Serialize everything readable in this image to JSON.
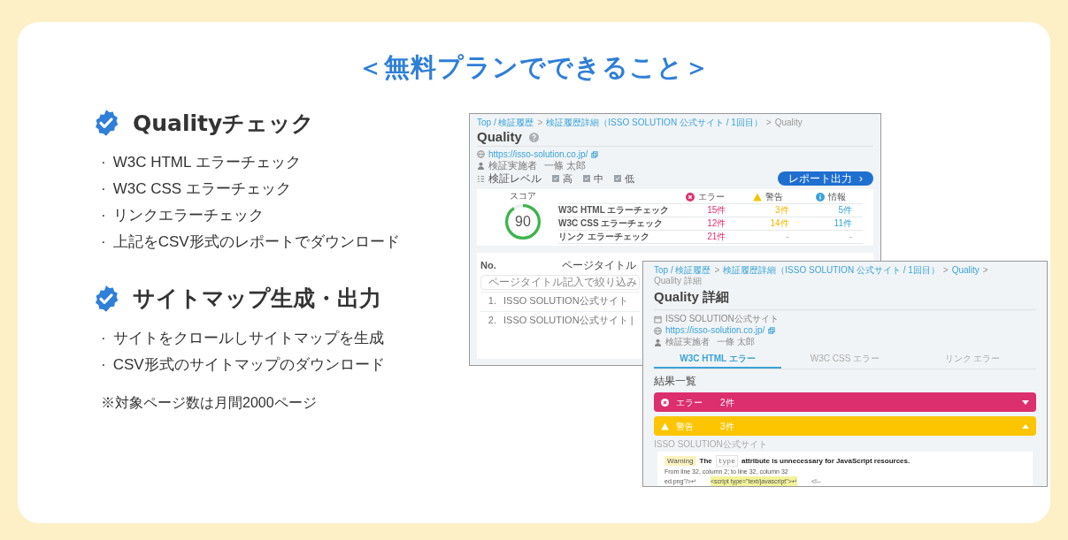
{
  "heading": "＜無料プランでできること＞",
  "features": [
    {
      "title": "Qualityチェック",
      "items": [
        {
          "marker": "·",
          "text": "W3C HTML エラーチェック"
        },
        {
          "marker": "·",
          "text": "W3C CSS エラーチェック"
        },
        {
          "marker": "·",
          "text": "リンクエラーチェック"
        },
        {
          "marker": "·",
          "text": "上記をCSV形式のレポートでダウンロード"
        }
      ]
    },
    {
      "title": "サイトマップ生成・出力",
      "items": [
        {
          "marker": "·",
          "text": "サイトをクロールしサイトマップを生成"
        },
        {
          "marker": "·",
          "text": "CSV形式のサイトマップのダウンロード"
        }
      ]
    }
  ],
  "note": "※対象ページ数は月間2000ページ",
  "quality_screen": {
    "breadcrumb": [
      {
        "label": "Top / 検証履歴",
        "link": true
      },
      {
        "label": ">",
        "link": false
      },
      {
        "label": "検証履歴詳細（ISSO SOLUTION 公式サイト / 1回目）",
        "link": true
      },
      {
        "label": ">",
        "link": false
      },
      {
        "label": "Quality",
        "link": false
      }
    ],
    "title": "Quality",
    "url": "https://isso-solution.co.jp/",
    "inspector_label": "検証実施者",
    "inspector": "一條 太郎",
    "level_label": "検証レベル",
    "levels": [
      {
        "label": "高",
        "checked": true
      },
      {
        "label": "中",
        "checked": true
      },
      {
        "label": "低",
        "checked": true
      }
    ],
    "report_button": "レポート出力",
    "report_button_icon": "›",
    "score_label": "スコア",
    "score": "90",
    "columns": [
      {
        "label": "エラー",
        "kind": "error"
      },
      {
        "label": "警告",
        "kind": "warning"
      },
      {
        "label": "情報",
        "kind": "info"
      }
    ],
    "rows": [
      {
        "label": "W3C HTML エラーチェック",
        "values": [
          "15件",
          "3件",
          "5件"
        ]
      },
      {
        "label": "W3C CSS エラーチェック",
        "values": [
          "12件",
          "14件",
          "11件"
        ]
      },
      {
        "label": "リンク エラーチェック",
        "values": [
          "21件",
          "-",
          "-"
        ]
      }
    ],
    "pages_table": {
      "no_header": "No.",
      "title_header": "ページタイトル",
      "search_placeholder": "ページタイトル記入で絞り込み",
      "rows": [
        {
          "no": "1.",
          "title": "ISSO SOLUTION公式サイト"
        },
        {
          "no": "2.",
          "title": "ISSO SOLUTION公式サイト |"
        }
      ]
    }
  },
  "detail_screen": {
    "breadcrumb": [
      {
        "label": "Top / 検証履歴",
        "link": true
      },
      {
        "label": ">",
        "link": false
      },
      {
        "label": "検証履歴詳細（ISSO SOLUTION 公式サイト / 1回目）",
        "link": true
      },
      {
        "label": ">",
        "link": false
      },
      {
        "label": "Quality",
        "link": true
      },
      {
        "label": ">",
        "link": false
      },
      {
        "label": "Quality 詳細",
        "link": false
      }
    ],
    "title": "Quality 詳細",
    "site": "ISSO SOLUTION公式サイト",
    "url": "https://isso-solution.co.jp/",
    "inspector_label": "検証実施者",
    "inspector": "一條 太郎",
    "tabs": [
      {
        "label": "W3C HTML エラー",
        "selected": true
      },
      {
        "label": "W3C CSS エラー",
        "selected": false
      },
      {
        "label": "リンク エラー",
        "selected": false
      }
    ],
    "results_title": "結果一覧",
    "groups": [
      {
        "kind": "error",
        "label": "エラー",
        "count": "2件",
        "expanded": false
      },
      {
        "kind": "warning",
        "label": "警告",
        "count": "3件",
        "expanded": true
      }
    ],
    "page_label": "ISSO SOLUTION公式サイト",
    "message": {
      "badge": "Warning",
      "before": "The",
      "code": "type",
      "after": "attribute is unnecessary for JavaScript resources.",
      "location": "From line 32, column 2; to line 32, column 32",
      "extract_before": "ed.png\"/>↵",
      "extract_highlight": "<script type=\"text/javascript\">↵",
      "extract_after": "<!--"
    }
  }
}
